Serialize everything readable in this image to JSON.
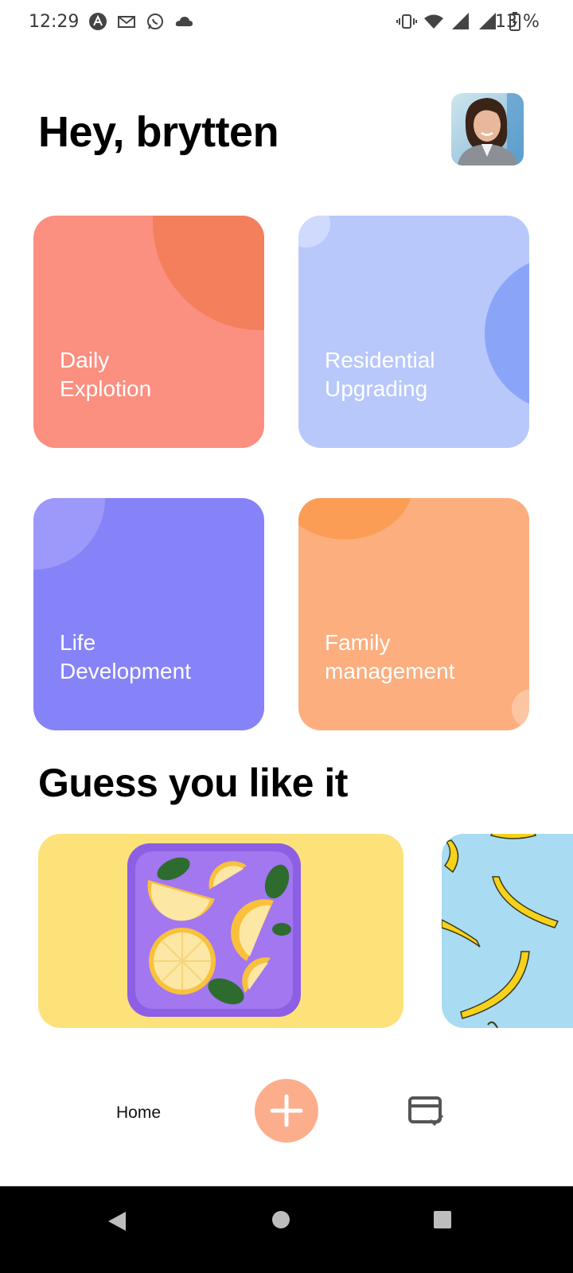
{
  "status_bar": {
    "time": "12:29",
    "battery_text": "13 %",
    "left_icons": [
      "app-a-icon",
      "gmail-icon",
      "whatsapp-icon",
      "cloud-icon"
    ],
    "right_icons": [
      "vibrate-icon",
      "wifi-icon",
      "signal-icon",
      "signal-icon",
      "battery-charging-icon"
    ]
  },
  "header": {
    "greeting": "Hey, brytten",
    "avatar": "user-avatar"
  },
  "categories": [
    {
      "label_line1": "Daily",
      "label_line2": "Explotion",
      "color": "#fb8f80"
    },
    {
      "label_line1": "Residential",
      "label_line2": "Upgrading",
      "color": "#b8c8fb"
    },
    {
      "label_line1": "Life",
      "label_line2": "Development",
      "color": "#8683f8"
    },
    {
      "label_line1": "Family",
      "label_line2": "management",
      "color": "#fcae7e"
    }
  ],
  "recommendations": {
    "title": "Guess you like it",
    "items": [
      {
        "image": "oranges-on-purple-plate",
        "bg": "#fde27a"
      },
      {
        "image": "bananas-pattern",
        "bg": "#a9dbf3"
      }
    ]
  },
  "bottom_nav": {
    "home_label": "Home",
    "fab_icon": "plus-icon",
    "right_icon": "card-check-icon",
    "fab_color": "#fcae8c"
  },
  "system_nav": [
    "back-icon",
    "home-circle-icon",
    "recents-icon"
  ]
}
